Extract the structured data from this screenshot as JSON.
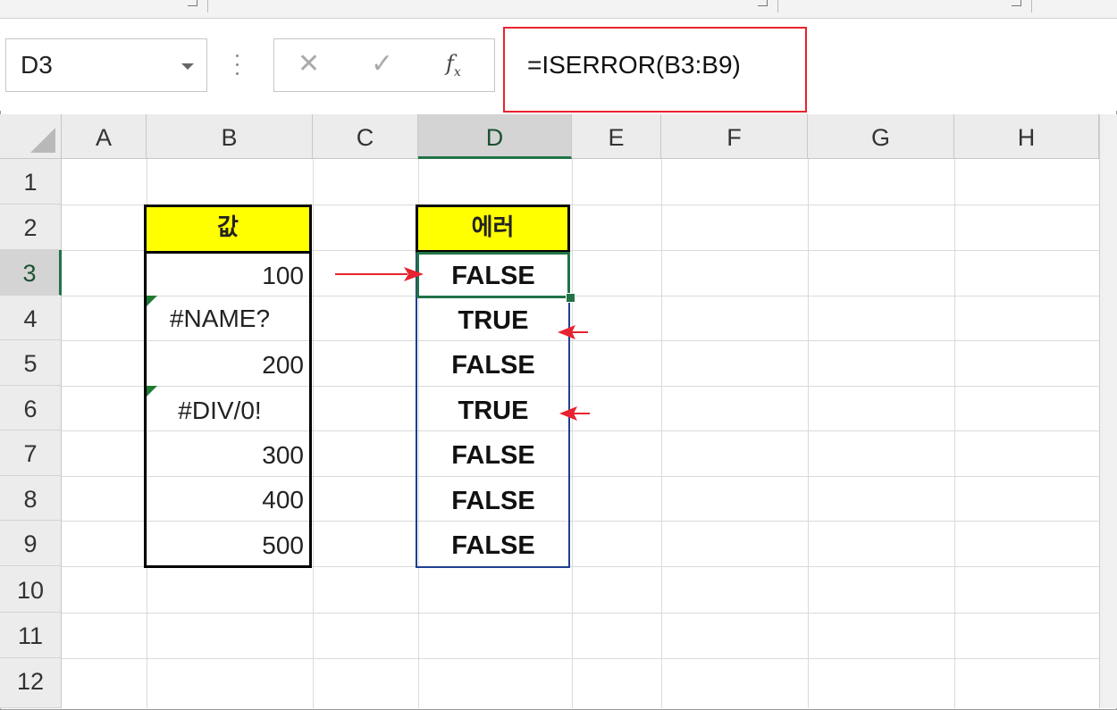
{
  "formula_bar": {
    "name_box": "D3",
    "cancel_icon": "✕",
    "enter_icon": "✓",
    "formula": "=ISERROR(B3:B9)"
  },
  "columns": [
    "A",
    "B",
    "C",
    "D",
    "E",
    "F",
    "G",
    "H"
  ],
  "selected_column": "D",
  "rows": [
    "1",
    "2",
    "3",
    "4",
    "5",
    "6",
    "7",
    "8",
    "9",
    "10",
    "11",
    "12"
  ],
  "selected_row": "3",
  "sheet": {
    "b_header": "값",
    "d_header": "에러",
    "b_values": [
      "100",
      "#NAME?",
      "200",
      "#DIV/0!",
      "300",
      "400",
      "500"
    ],
    "d_values": [
      "FALSE",
      "TRUE",
      "FALSE",
      "TRUE",
      "FALSE",
      "FALSE",
      "FALSE"
    ]
  },
  "colors": {
    "header_fill": "#ffff00",
    "selection": "#217346",
    "annotation": "#e8222f"
  }
}
